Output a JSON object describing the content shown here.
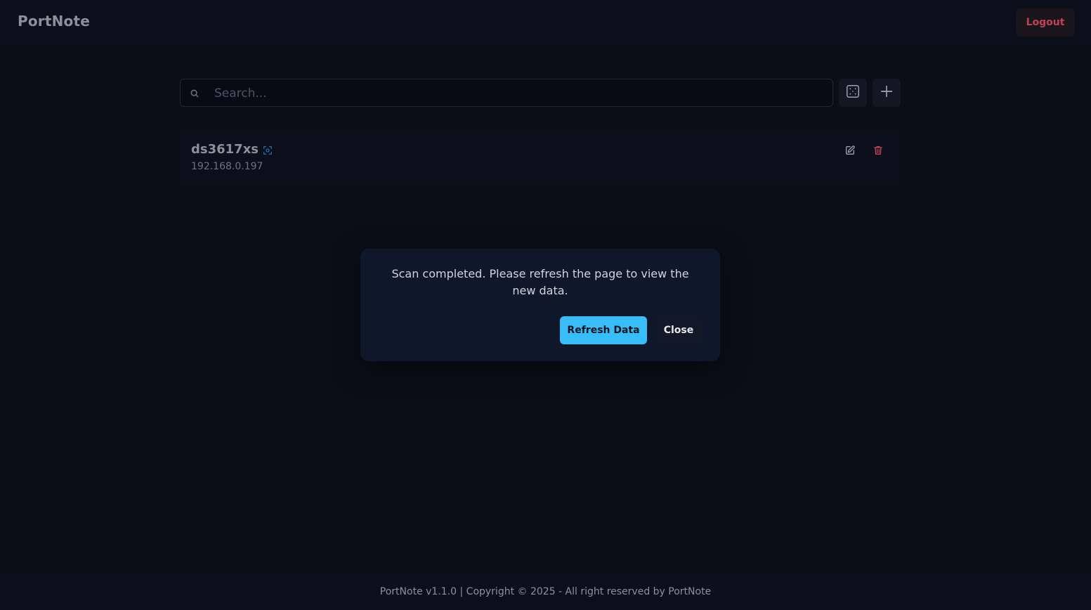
{
  "app": {
    "brand": "PortNote"
  },
  "header": {
    "logout_label": "Logout"
  },
  "search": {
    "placeholder": "Search...",
    "value": ""
  },
  "toolbar": {
    "scan_icon": "dice-scan-icon",
    "add_icon": "plus-icon"
  },
  "servers": [
    {
      "name": "ds3617xs",
      "ip": "192.168.0.197"
    }
  ],
  "modal": {
    "message": "Scan completed. Please refresh the page to view the new data.",
    "refresh_label": "Refresh Data",
    "close_label": "Close"
  },
  "footer": {
    "text": "PortNote v1.1.0 | Copyright © 2025 - All right reserved by PortNote"
  },
  "colors": {
    "background": "#0a0e17",
    "accent": "#38bdf8",
    "danger": "#c0415a",
    "modal_bg": "#0f172a"
  }
}
